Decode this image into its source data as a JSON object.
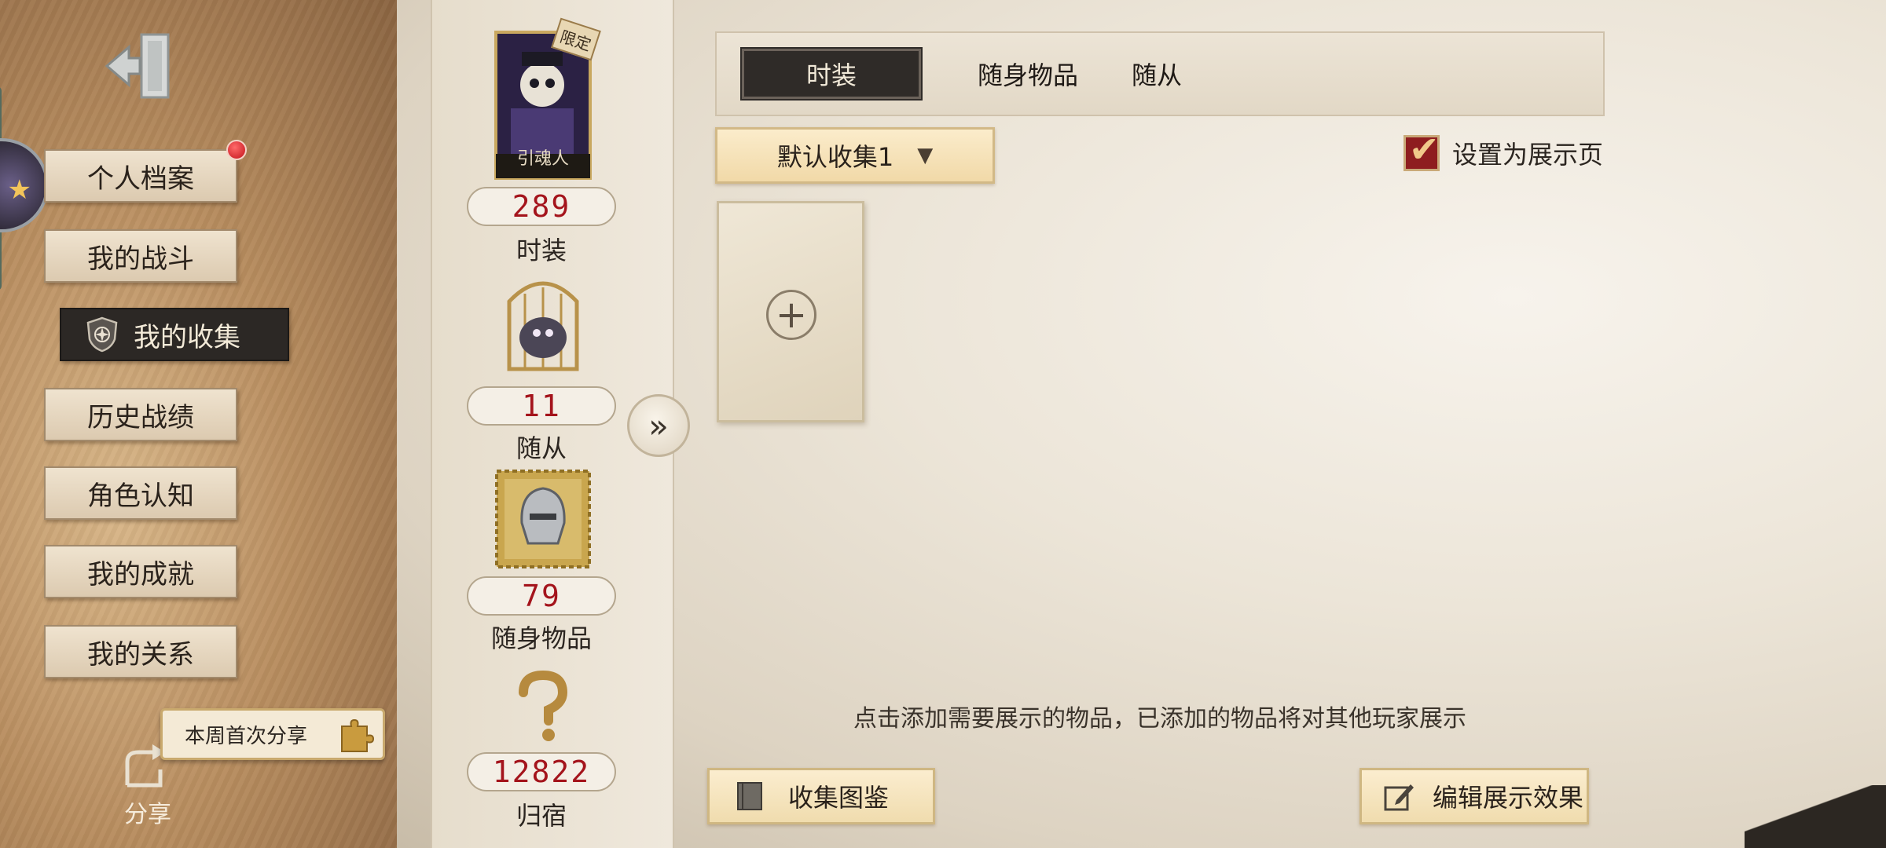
{
  "sidebar": {
    "menu": [
      {
        "label": "个人档案",
        "has_badge": true
      },
      {
        "label": "我的战斗"
      },
      {
        "label": "我的收集",
        "active": true
      },
      {
        "label": "历史战绩"
      },
      {
        "label": "角色认知"
      },
      {
        "label": "我的成就"
      },
      {
        "label": "我的关系"
      }
    ],
    "share_bubble": "本周首次分享",
    "share_label": "分享"
  },
  "stats": {
    "costume": {
      "badge": "限定",
      "name": "引魂人",
      "count": "289",
      "label": "时装"
    },
    "pet": {
      "count": "11",
      "label": "随从"
    },
    "accessory": {
      "count": "79",
      "label": "随身物品"
    },
    "home": {
      "count": "12822",
      "label": "归宿"
    }
  },
  "tabs": [
    "时装",
    "随身物品",
    "随从"
  ],
  "active_tab": "时装",
  "dropdown": {
    "value": "默认收集1"
  },
  "showcase_checkbox": {
    "label": "设置为展示页",
    "checked": true
  },
  "hint": "点击添加需要展示的物品，已添加的物品将对其他玩家展示",
  "buttons": {
    "collection_book": "收集图鉴",
    "edit_display": "编辑展示效果"
  },
  "colors": {
    "accent_red": "#a4141c",
    "active_dark": "#2f2b28",
    "gold": "#d2b987"
  }
}
